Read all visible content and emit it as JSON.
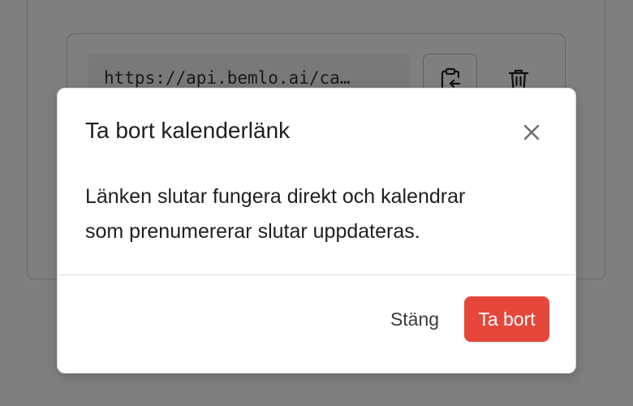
{
  "background": {
    "calendar_link_url": "https://api.bemlo.ai/ca…",
    "copy_icon": "clipboard-copy-icon",
    "delete_icon": "trash-icon"
  },
  "dialog": {
    "title": "Ta bort kalenderlänk",
    "close_icon": "close-icon",
    "body_line_1": "Länken slutar fungera direkt och kalendrar",
    "body_line_2": "som prenumererar slutar uppdateras.",
    "cancel_label": "Stäng",
    "confirm_label": "Ta bort",
    "confirm_color": "#e5483b",
    "overlay_color": "rgba(0,0,0,0.5)"
  }
}
